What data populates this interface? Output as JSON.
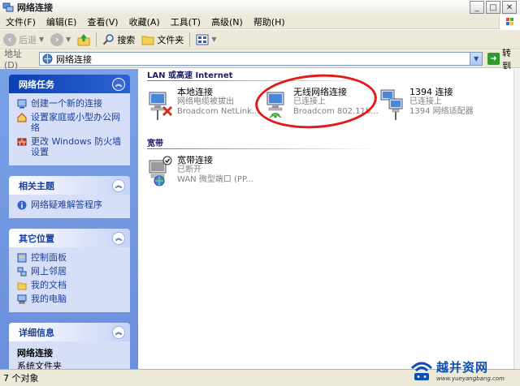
{
  "window": {
    "title": "网络连接",
    "min_glyph": "_",
    "max_glyph": "□",
    "close_glyph": "✕"
  },
  "menu": [
    "文件(F)",
    "编辑(E)",
    "查看(V)",
    "收藏(A)",
    "工具(T)",
    "高级(N)",
    "帮助(H)"
  ],
  "toolbar": {
    "back_label": "后退",
    "search_label": "搜索",
    "folders_label": "文件夹"
  },
  "address": {
    "label": "地址(D)",
    "value": "网络连接",
    "go_label": "转到"
  },
  "tasks": {
    "network": {
      "title": "网络任务",
      "items": [
        "创建一个新的连接",
        "设置家庭或小型办公网络",
        "更改 Windows 防火墙设置"
      ]
    },
    "related": {
      "title": "相关主题",
      "items": [
        "网络疑难解答程序"
      ]
    },
    "other": {
      "title": "其它位置",
      "items": [
        "控制面板",
        "网上邻居",
        "我的文档",
        "我的电脑"
      ]
    },
    "details": {
      "title": "详细信息",
      "name": "网络连接",
      "sub": "系统文件夹"
    }
  },
  "groups": {
    "lan": {
      "header": "LAN 或高速 Internet",
      "connections": [
        {
          "name": "本地连接",
          "status": "网络电缆被拔出",
          "device": "Broadcom NetLink..."
        },
        {
          "name": "无线网络连接",
          "status": "已连接上",
          "device": "Broadcom 802.11b..."
        },
        {
          "name": "1394 连接",
          "status": "已连接上",
          "device": "1394 网络适配器"
        }
      ]
    },
    "broadband": {
      "header": "宽带",
      "connections": [
        {
          "name": "宽带连接",
          "status": "已断开",
          "device": "WAN 微型端口 (PP..."
        }
      ]
    }
  },
  "status": {
    "text": "7 个对象"
  },
  "watermark": {
    "name": "越并资网",
    "url": "www.yueyangbang.com"
  },
  "colors": {
    "taskpane": "#6b8fdc",
    "annotation": "#e41a1a",
    "link": "#1b3f9a"
  }
}
